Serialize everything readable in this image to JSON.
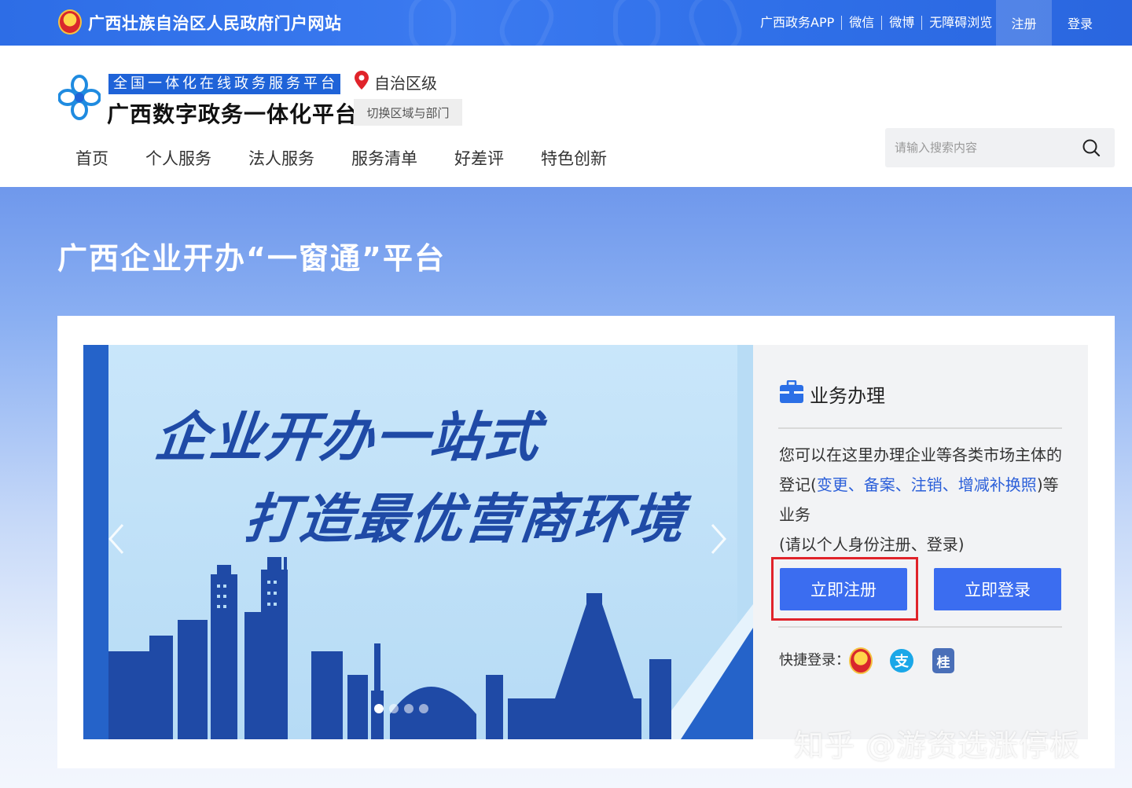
{
  "top_bar": {
    "site_title": "广西壮族自治区人民政府门户网站",
    "links": [
      "广西政务APP",
      "微信",
      "微博",
      "无障碍浏览"
    ],
    "register_label": "注册",
    "login_label": "登录"
  },
  "header": {
    "slogan": "全国一体化在线政务服务平台",
    "platform_name": "广西数字政务一体化平台",
    "region": "自治区级",
    "switch_label": "切换区域与部门"
  },
  "nav": {
    "items": [
      "首页",
      "个人服务",
      "法人服务",
      "服务清单",
      "好差评",
      "特色创新"
    ]
  },
  "search": {
    "placeholder": "请输入搜索内容",
    "value": ""
  },
  "hero": {
    "title": "广西企业开办“一窗通”平台"
  },
  "banner": {
    "line1": "企业开办一站式",
    "line2": "打造最优营商环境",
    "slide_count": 4,
    "active_slide": 1
  },
  "panel": {
    "title": "业务办理",
    "desc_prefix": "您可以在这里办理企业等各类市场主体的登记(",
    "desc_links": "变更、备案、注销、增减补换照",
    "desc_suffix": ")等业务",
    "desc_note": "(请以个人身份注册、登录)",
    "register_button": "立即注册",
    "login_button": "立即登录",
    "quick_login_label": "快捷登录：",
    "quick_login_icons": [
      "gov-emblem-icon",
      "alipay-icon",
      "guangxi-app-icon"
    ],
    "alipay_glyph": "支",
    "gui_glyph": "桂"
  },
  "watermark": "知乎 @游资选涨停板",
  "colors": {
    "brand_blue": "#2d6de6",
    "button_blue": "#3b6df0",
    "highlight_red": "#e0232a",
    "link_blue": "#2b5fd9"
  }
}
